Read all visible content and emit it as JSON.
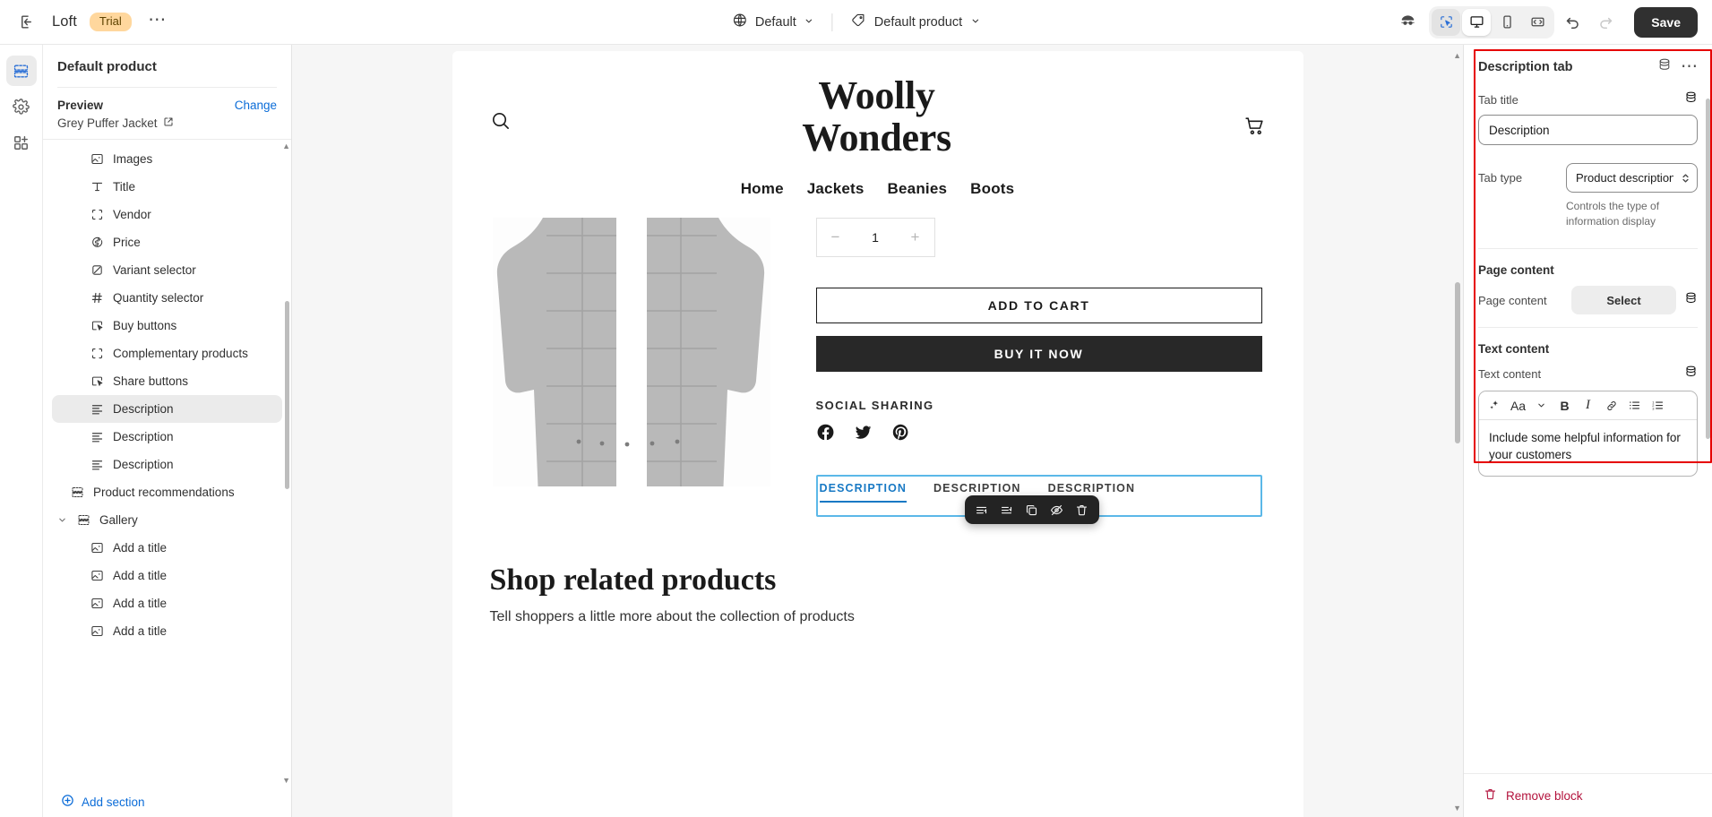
{
  "topbar": {
    "exit_icon": "exit-icon",
    "shop_name": "Loft",
    "trial_badge": "Trial",
    "more_menu": "…",
    "theme_selector": "Default",
    "template_selector": "Default product",
    "globe_icon": "globe-icon",
    "tag_icon": "tag-icon",
    "inspector_icon": "inspector-icon",
    "select_tool_icon": "cursor-select-icon",
    "desktop_icon": "desktop-icon",
    "mobile_icon": "mobile-icon",
    "fullwidth_icon": "full-width-icon",
    "undo_icon": "undo-icon",
    "redo_icon": "redo-icon",
    "save_label": "Save"
  },
  "rail": {
    "items": [
      {
        "name": "sections-icon",
        "active": true
      },
      {
        "name": "settings-gear-icon",
        "active": false
      },
      {
        "name": "apps-icon",
        "active": false
      }
    ]
  },
  "leftpanel": {
    "title": "Default product",
    "preview_label": "Preview",
    "change_label": "Change",
    "preview_product": "Grey Puffer Jacket",
    "external_link_icon": "external-link-icon",
    "tree": [
      {
        "label": "Images",
        "icon": "image-icon",
        "indent": 1,
        "active": false
      },
      {
        "label": "Title",
        "icon": "text-title-icon",
        "indent": 1,
        "active": false
      },
      {
        "label": "Vendor",
        "icon": "placeholder-box-icon",
        "indent": 1,
        "active": false
      },
      {
        "label": "Price",
        "icon": "price-tag-icon",
        "indent": 1,
        "active": false
      },
      {
        "label": "Variant selector",
        "icon": "variant-icon",
        "indent": 1,
        "active": false
      },
      {
        "label": "Quantity selector",
        "icon": "hash-icon",
        "indent": 1,
        "active": false
      },
      {
        "label": "Buy buttons",
        "icon": "buy-button-icon",
        "indent": 1,
        "active": false
      },
      {
        "label": "Complementary products",
        "icon": "placeholder-box-icon",
        "indent": 1,
        "active": false
      },
      {
        "label": "Share buttons",
        "icon": "buy-button-icon",
        "indent": 1,
        "active": false
      },
      {
        "label": "Description",
        "icon": "text-lines-icon",
        "indent": 1,
        "active": true
      },
      {
        "label": "Description",
        "icon": "text-lines-icon",
        "indent": 1,
        "active": false
      },
      {
        "label": "Description",
        "icon": "text-lines-icon",
        "indent": 1,
        "active": false
      },
      {
        "label": "Product recommendations",
        "icon": "section-icon",
        "indent": 0,
        "active": false
      },
      {
        "label": "Gallery",
        "icon": "section-icon",
        "indent": 0,
        "active": false,
        "caret": "⌄"
      },
      {
        "label": "Add a title",
        "icon": "image-icon",
        "indent": 1,
        "active": false
      },
      {
        "label": "Add a title",
        "icon": "image-icon",
        "indent": 1,
        "active": false
      },
      {
        "label": "Add a title",
        "icon": "image-icon",
        "indent": 1,
        "active": false
      },
      {
        "label": "Add a title",
        "icon": "image-icon",
        "indent": 1,
        "active": false
      }
    ],
    "add_section_label": "Add section",
    "add_section_icon": "plus-circle-icon"
  },
  "preview": {
    "search_icon": "search-icon",
    "cart_icon": "cart-icon",
    "logo_line1": "Woolly",
    "logo_line2": "Wonders",
    "nav": [
      "Home",
      "Jackets",
      "Beanies",
      "Boots"
    ],
    "quantity_value": "1",
    "quantity_minus": "−",
    "quantity_plus": "+",
    "add_to_cart": "ADD TO CART",
    "buy_it_now": "BUY IT NOW",
    "social_title": "SOCIAL SHARING",
    "social_icons": [
      "facebook-icon",
      "twitter-icon",
      "pinterest-icon"
    ],
    "desc_tabs": [
      "DESCRIPTION",
      "DESCRIPTION",
      "DESCRIPTION"
    ],
    "floating_toolbar_icons": [
      "move-up-icon",
      "move-down-icon",
      "duplicate-icon",
      "hide-icon",
      "delete-icon"
    ],
    "related_title": "Shop related products",
    "related_sub": "Tell shoppers a little more about the collection of products"
  },
  "rightpanel": {
    "title": "Description tab",
    "db_icon": "dynamic-source-icon",
    "more_icon": "more-menu-icon",
    "tab_title_label": "Tab title",
    "tab_title_value": "Description",
    "tab_type_label": "Tab type",
    "tab_type_value": "Product description",
    "tab_type_options": [
      "Product description"
    ],
    "tab_type_help": "Controls the type of information display",
    "page_content_heading": "Page content",
    "page_content_label": "Page content",
    "page_content_select_btn": "Select",
    "text_content_heading": "Text content",
    "text_content_label": "Text content",
    "rte_toolbar_icons": [
      "ai-sparkle-icon",
      "font-size-icon",
      "chevron-down-icon",
      "bold-icon",
      "italic-icon",
      "link-icon",
      "bullet-list-icon",
      "numbered-list-icon"
    ],
    "rte_bold": "B",
    "rte_italic": "I",
    "rte_font": "Aa",
    "text_content_value": "Include some helpful information for your customers",
    "remove_block_label": "Remove block",
    "trash_icon": "trash-icon",
    "highlight_color": "#e60000"
  }
}
